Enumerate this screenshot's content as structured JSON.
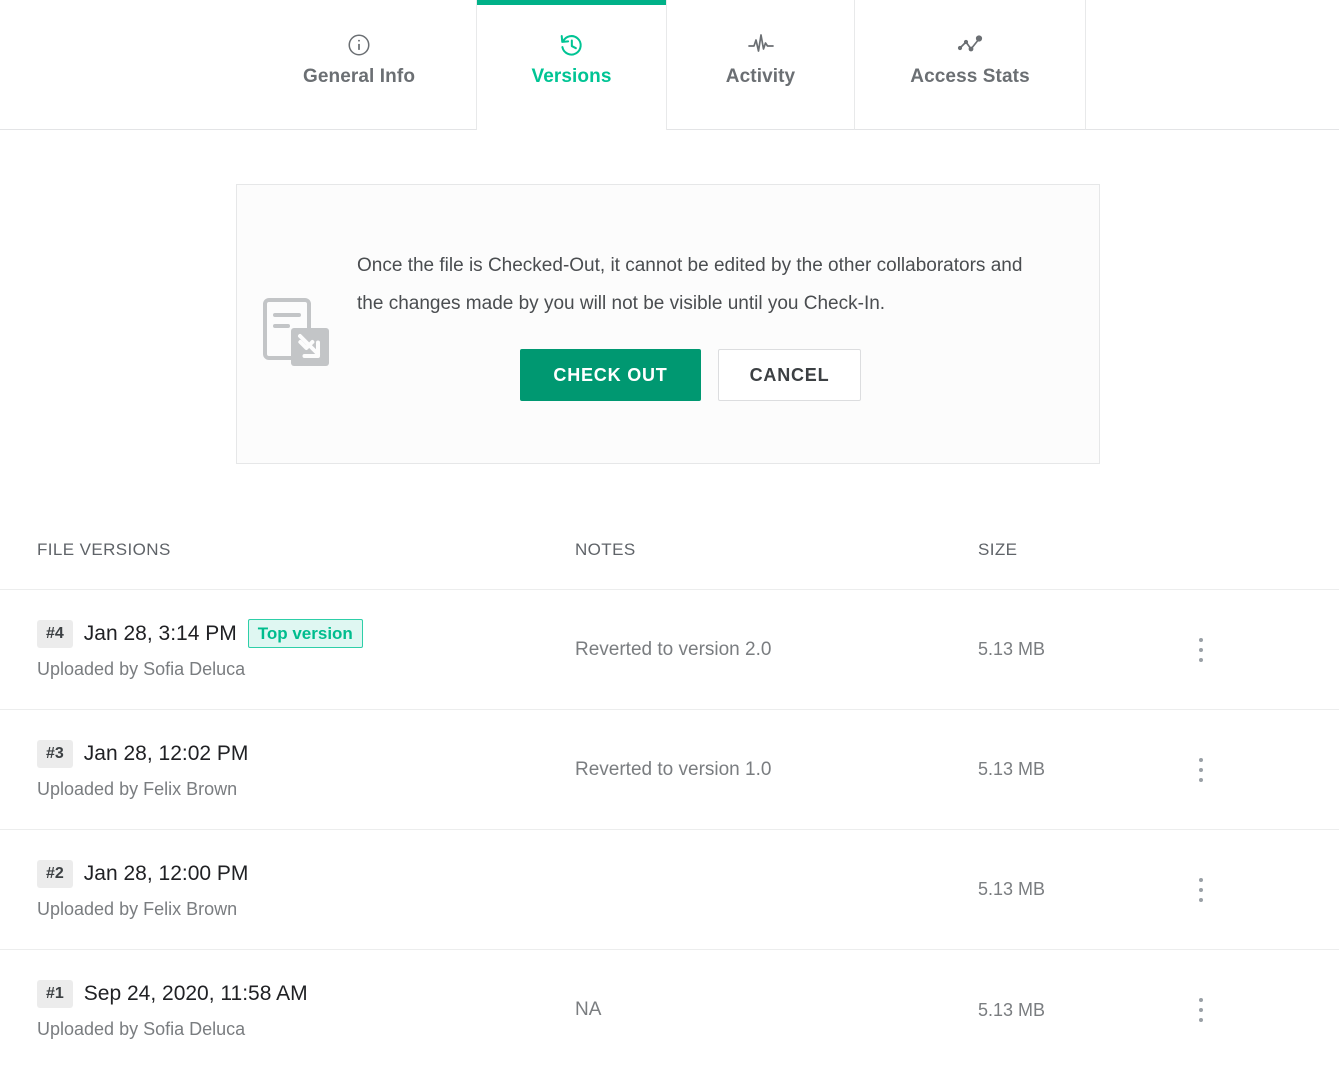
{
  "tabs": [
    {
      "label": "General Info",
      "icon": "info-circle-icon",
      "active": false
    },
    {
      "label": "Versions",
      "icon": "history-icon",
      "active": true
    },
    {
      "label": "Activity",
      "icon": "pulse-icon",
      "active": false
    },
    {
      "label": "Access Stats",
      "icon": "trend-dots-icon",
      "active": false
    }
  ],
  "checkout": {
    "icon": "document-check-out-icon",
    "message": "Once the file is Checked-Out, it cannot be edited by the other collaborators and the changes made by you will not be visible until you Check-In.",
    "primary_label": "CHECK OUT",
    "secondary_label": "CANCEL"
  },
  "table": {
    "headers": {
      "name": "FILE VERSIONS",
      "notes": "NOTES",
      "size": "SIZE"
    },
    "rows": [
      {
        "number": "#4",
        "date": "Jan 28, 3:14 PM",
        "badge": "Top version",
        "uploader": "Uploaded by Sofia Deluca",
        "note": "Reverted to version 2.0",
        "size": "5.13 MB"
      },
      {
        "number": "#3",
        "date": "Jan 28, 12:02 PM",
        "badge": "",
        "uploader": "Uploaded by Felix Brown",
        "note": "Reverted to version 1.0",
        "size": "5.13 MB"
      },
      {
        "number": "#2",
        "date": "Jan 28, 12:00 PM",
        "badge": "",
        "uploader": "Uploaded by Felix Brown",
        "note": "",
        "size": "5.13 MB"
      },
      {
        "number": "#1",
        "date": "Sep 24, 2020, 11:58 AM",
        "badge": "",
        "uploader": "Uploaded by Sofia Deluca",
        "note": "NA",
        "size": "5.13 MB"
      }
    ]
  },
  "colors": {
    "accent_teal": "#00c494",
    "button_green": "#009871",
    "badge_border": "#2ecfa8",
    "badge_bg": "#dff7f2",
    "text_muted": "#7a7d80"
  }
}
